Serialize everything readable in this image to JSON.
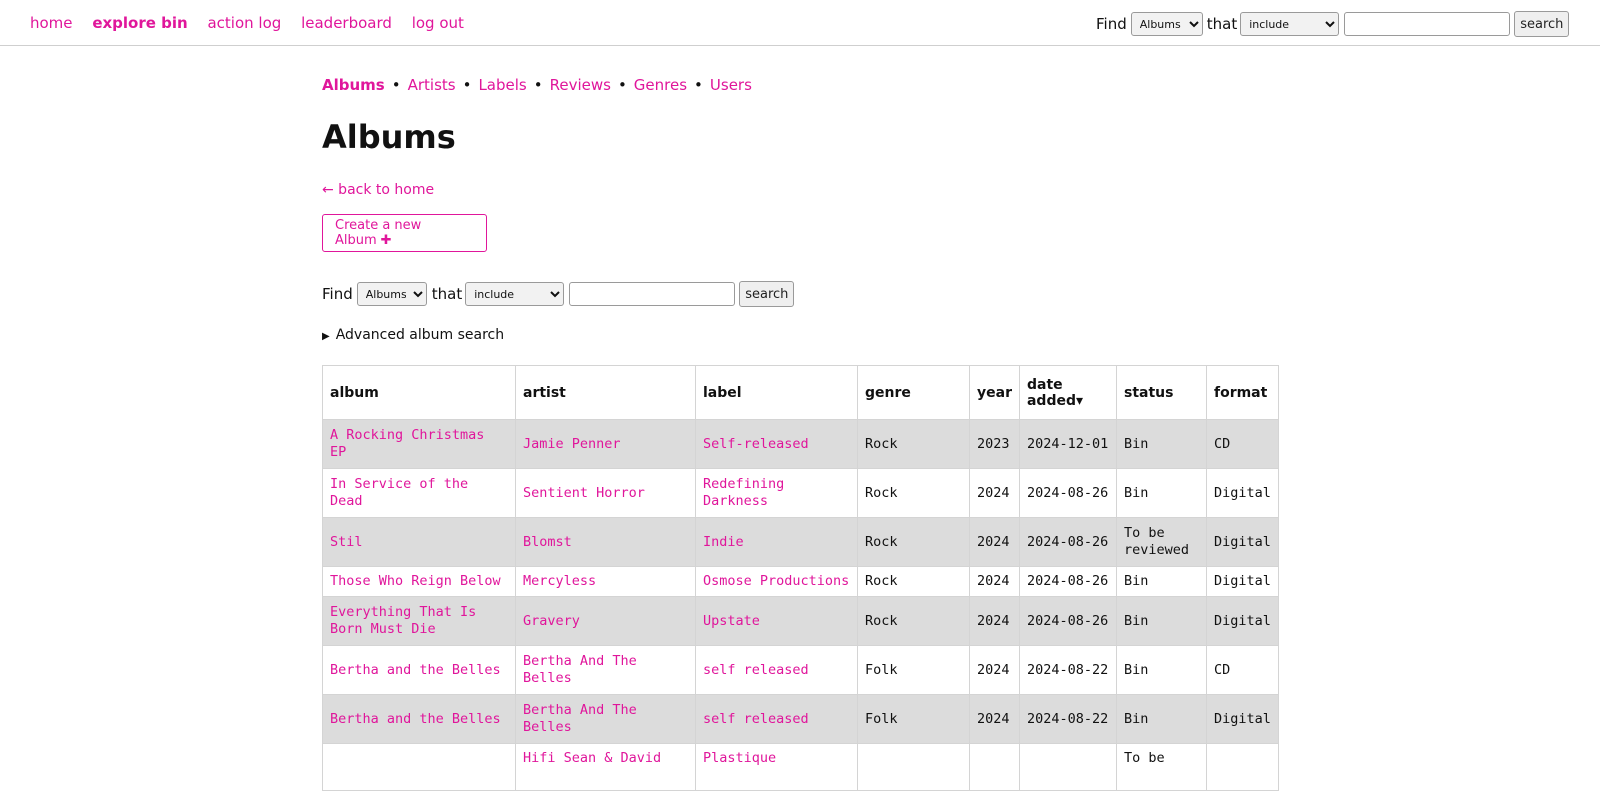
{
  "topnav": {
    "items": [
      {
        "label": "home"
      },
      {
        "label": "explore bin",
        "active": true
      },
      {
        "label": "action log"
      },
      {
        "label": "leaderboard"
      },
      {
        "label": "log out"
      }
    ]
  },
  "topsearch": {
    "find_label": "Find",
    "type_value": "Albums",
    "that_label": "that",
    "mode_value": "include",
    "query_value": "",
    "button_label": "search"
  },
  "subnav": {
    "items": [
      {
        "label": "Albums",
        "active": true
      },
      {
        "label": "Artists"
      },
      {
        "label": "Labels"
      },
      {
        "label": "Reviews"
      },
      {
        "label": "Genres"
      },
      {
        "label": "Users"
      }
    ],
    "separator": "•"
  },
  "page": {
    "title": "Albums",
    "back_label": "← back to home",
    "create_label": "Create a new Album",
    "create_icon": "plus-icon"
  },
  "search": {
    "find_label": "Find",
    "type_value": "Albums",
    "that_label": "that",
    "mode_value": "include",
    "query_value": "",
    "button_label": "search"
  },
  "advanced": {
    "label": "Advanced album search"
  },
  "table": {
    "headers": {
      "album": "album",
      "artist": "artist",
      "label": "label",
      "genre": "genre",
      "year": "year",
      "date_added_line1": "date",
      "date_added_line2": "added▾",
      "status": "status",
      "format": "format"
    },
    "rows": [
      {
        "album": "A Rocking Christmas EP",
        "artist": "Jamie Penner",
        "label": "Self-released",
        "genre": "Rock",
        "year": "2023",
        "date": "2024-12-01",
        "status": "Bin",
        "format": "CD"
      },
      {
        "album": "In Service of the Dead",
        "artist": "Sentient Horror",
        "label": "Redefining Darkness",
        "genre": "Rock",
        "year": "2024",
        "date": "2024-08-26",
        "status": "Bin",
        "format": "Digital"
      },
      {
        "album": "Stil",
        "artist": "Blomst",
        "label": "Indie",
        "genre": "Rock",
        "year": "2024",
        "date": "2024-08-26",
        "status": "To be reviewed",
        "format": "Digital"
      },
      {
        "album": "Those Who Reign Below",
        "artist": "Mercyless",
        "label": "Osmose Productions",
        "genre": "Rock",
        "year": "2024",
        "date": "2024-08-26",
        "status": "Bin",
        "format": "Digital"
      },
      {
        "album": "Everything That Is Born Must Die",
        "artist": "Gravery",
        "label": "Upstate",
        "genre": "Rock",
        "year": "2024",
        "date": "2024-08-26",
        "status": "Bin",
        "format": "Digital"
      },
      {
        "album": "Bertha and the Belles",
        "artist": "Bertha And The Belles",
        "label": "self released",
        "genre": "Folk",
        "year": "2024",
        "date": "2024-08-22",
        "status": "Bin",
        "format": "CD"
      },
      {
        "album": "Bertha and the Belles",
        "artist": "Bertha And The Belles",
        "label": "self released",
        "genre": "Folk",
        "year": "2024",
        "date": "2024-08-22",
        "status": "Bin",
        "format": "Digital"
      },
      {
        "album": "",
        "artist": "Hifi Sean & David",
        "label": "Plastique",
        "genre": "",
        "year": "",
        "date": "",
        "status": "To be",
        "format": ""
      }
    ]
  },
  "colors": {
    "accent": "#e0169b",
    "row_alt": "#dcdcdc",
    "border": "#d4d4d4"
  }
}
